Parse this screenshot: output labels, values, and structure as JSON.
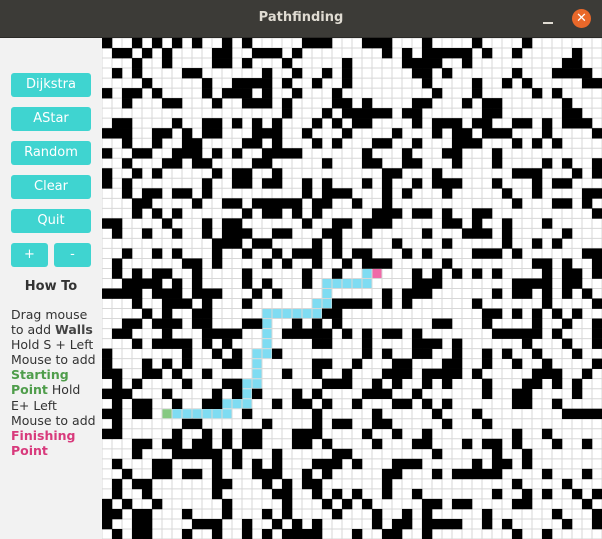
{
  "window": {
    "title": "Pathfinding",
    "close_glyph": "✕"
  },
  "sidebar": {
    "buttons": [
      "Dijkstra",
      "AStar",
      "Random",
      "Clear",
      "Quit"
    ],
    "plus": "+",
    "minus": "-",
    "how_to_title": "How To",
    "instructions": {
      "l1": "Drag mouse to add ",
      "walls": "Walls",
      "l2": " Hold S + Left Mouse to add ",
      "starting": "Starting Point",
      "l3": " Hold E+ Left Mouse to add ",
      "finishing": "Finishing Point"
    }
  },
  "colors": {
    "accent": "#3fd4d0",
    "wall": "#000000",
    "path": "#7fdcf2",
    "start": "#86c982",
    "finish": "#f06aa8",
    "grid_line": "#d7d7d7"
  },
  "grid": {
    "cols": 50,
    "rows": 50
  },
  "markers": {
    "start": {
      "col": 6,
      "row": 37
    },
    "finish": {
      "col": 27,
      "row": 23
    }
  },
  "path": [
    [
      7,
      37
    ],
    [
      8,
      37
    ],
    [
      9,
      37
    ],
    [
      10,
      37
    ],
    [
      11,
      37
    ],
    [
      12,
      37
    ],
    [
      12,
      36
    ],
    [
      13,
      36
    ],
    [
      14,
      36
    ],
    [
      14,
      35
    ],
    [
      14,
      34
    ],
    [
      15,
      34
    ],
    [
      15,
      33
    ],
    [
      15,
      32
    ],
    [
      15,
      31
    ],
    [
      16,
      31
    ],
    [
      16,
      30
    ],
    [
      16,
      29
    ],
    [
      16,
      28
    ],
    [
      16,
      27
    ],
    [
      17,
      27
    ],
    [
      18,
      27
    ],
    [
      19,
      27
    ],
    [
      20,
      27
    ],
    [
      21,
      27
    ],
    [
      21,
      26
    ],
    [
      22,
      26
    ],
    [
      22,
      25
    ],
    [
      22,
      24
    ],
    [
      23,
      24
    ],
    [
      24,
      24
    ],
    [
      25,
      24
    ],
    [
      26,
      24
    ],
    [
      26,
      23
    ]
  ]
}
